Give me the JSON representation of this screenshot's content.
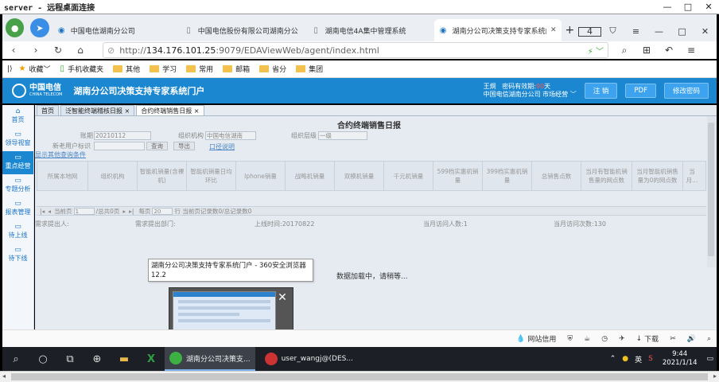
{
  "remote_window": {
    "title": "server - 远程桌面连接",
    "min": "—",
    "max": "□",
    "close": "✕"
  },
  "tabs": [
    {
      "label": "中国电信湖南分公司",
      "active": false
    },
    {
      "label": "中国电信股份有限公司湖南分公",
      "active": false
    },
    {
      "label": "湖南电信4A集中管理系统",
      "active": false
    },
    {
      "label": "湖南分公司决策支持专家系统门",
      "active": true
    }
  ],
  "tab_count_badge": "4",
  "address": {
    "url_prefix": "http://",
    "url_host": "134.176.101.25",
    "url_rest": ":9079/EDAViewWeb/agent/index.html"
  },
  "bookmarks": [
    {
      "label": "收藏",
      "icon": "star-icon"
    },
    {
      "label": "手机收藏夹",
      "icon": "phone-icon"
    },
    {
      "label": "其他",
      "icon": "folder-icon"
    },
    {
      "label": "学习",
      "icon": "folder-icon"
    },
    {
      "label": "常用",
      "icon": "folder-icon"
    },
    {
      "label": "邮箱",
      "icon": "folder-icon"
    },
    {
      "label": "省分",
      "icon": "folder-icon"
    },
    {
      "label": "集团",
      "icon": "folder-icon"
    }
  ],
  "portal": {
    "logo_cn": "中国电信",
    "logo_en": "CHINA TELECOM",
    "title": "湖南分公司决策支持专家系统门户",
    "user_name": "王炯",
    "pwd_label": "密码有效期:",
    "pwd_days": "90",
    "pwd_unit": "天",
    "org": "中国电信湖南分公司 市场经营 ﹀",
    "btn_logout": "注 销",
    "btn_pdf": "PDF",
    "btn_change_pwd": "修改密码"
  },
  "sidebar": [
    {
      "label": "首页",
      "active": false
    },
    {
      "label": "领导视窗",
      "active": false
    },
    {
      "label": "重点经营",
      "active": true
    },
    {
      "label": "专题分析",
      "active": false
    },
    {
      "label": "报表管理",
      "active": false
    },
    {
      "label": "待上线",
      "active": false
    },
    {
      "label": "待下线",
      "active": false
    }
  ],
  "page_tabs": [
    {
      "label": "首页"
    },
    {
      "label": "泛智能终端稽核日报 ×"
    },
    {
      "label": "合约终端销售日报 ×"
    }
  ],
  "report": {
    "title": "合约终端销售日报",
    "period_label": "账期",
    "period_value": "20210112",
    "org_label": "组织机构",
    "org_value": "中国电信湖南",
    "level_label": "组织层级",
    "level_value": "一级",
    "user_flag_label": "新老用户标识",
    "btn_query": "查询",
    "btn_export": "导出",
    "link_note": "口径说明",
    "link_other": "显示其他查询条件",
    "columns": [
      "所属本地网",
      "组织机构",
      "智能机销量(含裸机)",
      "智能机销量日均环比",
      "Iphone销量",
      "战略机销量",
      "双模机销量",
      "千元机销量",
      "599档实惠机销量",
      "399档实惠机销量",
      "总销售点数",
      "当月有智能机销售量的网点数",
      "当月智能机销售量为0的网点数",
      "当月..."
    ],
    "pager": {
      "current_label": "当前页",
      "current_value": "1",
      "total_label": "/总共0页",
      "per_page_label": "每页",
      "per_page_value": "20",
      "records": "行 当前页记录数0/总记录数0"
    },
    "info": {
      "requester": "需求提出人:",
      "dept": "需求提出部门:",
      "online_time": "上线时间:20170822",
      "visitors": "当月访问人数:1",
      "visits": "当月访问次数:130"
    },
    "loading": "数据加载中，请稍等..."
  },
  "tooltip": {
    "line1": "湖南分公司决策支持专家系统门户 - 360安全浏览器",
    "line2": "12.2"
  },
  "statusbar": [
    "网站信用",
    "下载"
  ],
  "taskbar": {
    "apps": [
      {
        "label": "湖南分公司决策支...",
        "active": true
      },
      {
        "label": "user_wangj@(DES...",
        "active": false
      }
    ],
    "ime": "英",
    "time": "9:44",
    "date": "2021/1/14"
  }
}
